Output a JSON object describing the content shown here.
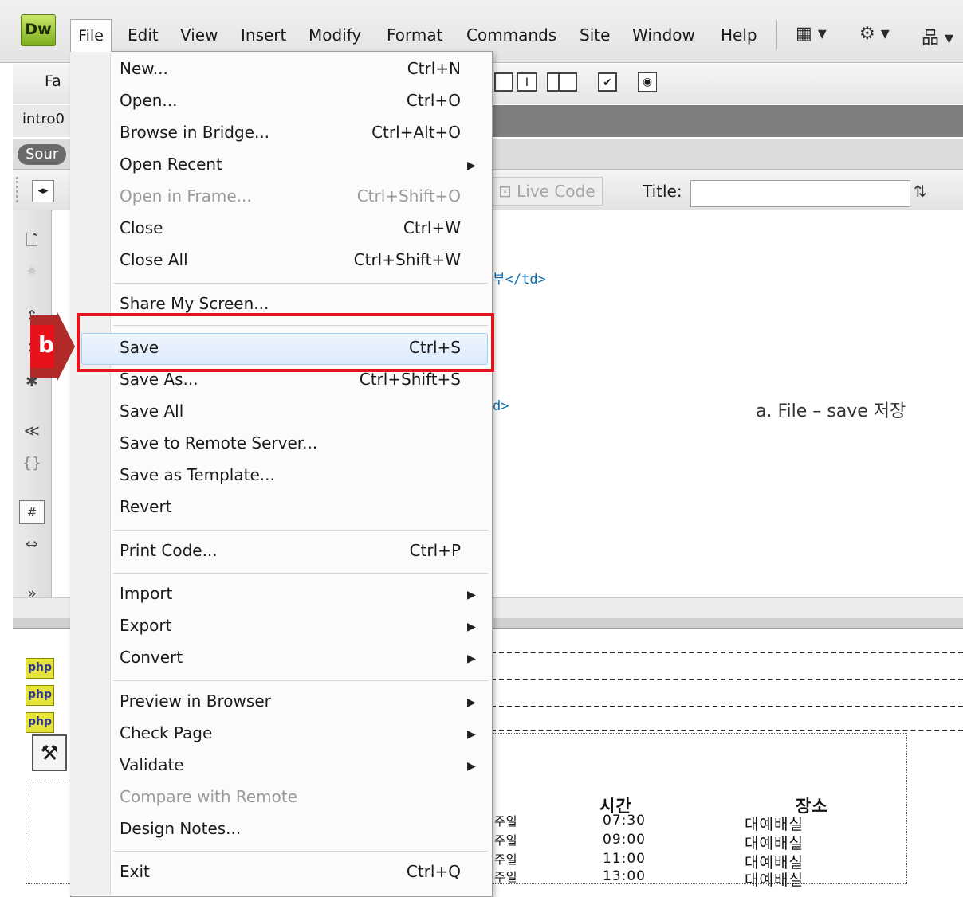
{
  "app": {
    "logo_text": "Dw"
  },
  "menubar": {
    "items": [
      "File",
      "Edit",
      "View",
      "Insert",
      "Modify",
      "Format",
      "Commands",
      "Site",
      "Window",
      "Help"
    ],
    "layout_icon": "layout-icon",
    "gear_icon": "gear-icon",
    "site_icon": "site-icon"
  },
  "insert_toolbar": {
    "category_label": "Fa"
  },
  "document": {
    "tab_name": "intro0",
    "source_label": "Sour"
  },
  "doc_toolbar": {
    "live_code_label": "Live Code",
    "title_label": "Title:",
    "title_value": ""
  },
  "code_view": {
    "line1": "부</td>",
    "line2": "d>"
  },
  "annotation": {
    "text": "a.   File – save 저장"
  },
  "design_view": {
    "php_badge": "php",
    "header_time": "시간",
    "header_place": "장소",
    "rows": [
      {
        "day": "주일",
        "time": "07:30",
        "place": "대예배실"
      },
      {
        "day": "주일",
        "time": "09:00",
        "place": "대예배실"
      },
      {
        "day": "주일",
        "time": "11:00",
        "place": "대예배실"
      },
      {
        "day": "주일",
        "time": "13:00",
        "place": "대예배실"
      }
    ]
  },
  "file_menu": {
    "items": [
      {
        "label": "New...",
        "shortcut": "Ctrl+N"
      },
      {
        "label": "Open...",
        "shortcut": "Ctrl+O"
      },
      {
        "label": "Browse in Bridge...",
        "shortcut": "Ctrl+Alt+O"
      },
      {
        "label": "Open Recent",
        "shortcut": ""
      },
      {
        "label": "Open in Frame...",
        "shortcut": "Ctrl+Shift+O"
      },
      {
        "label": "Close",
        "shortcut": "Ctrl+W"
      },
      {
        "label": "Close All",
        "shortcut": "Ctrl+Shift+W"
      },
      {
        "label": "Share My Screen...",
        "shortcut": ""
      },
      {
        "label": "Save",
        "shortcut": "Ctrl+S"
      },
      {
        "label": "Save As...",
        "shortcut": "Ctrl+Shift+S"
      },
      {
        "label": "Save All",
        "shortcut": ""
      },
      {
        "label": "Save to Remote Server...",
        "shortcut": ""
      },
      {
        "label": "Save as Template...",
        "shortcut": ""
      },
      {
        "label": "Revert",
        "shortcut": ""
      },
      {
        "label": "Print Code...",
        "shortcut": "Ctrl+P"
      },
      {
        "label": "Import",
        "shortcut": ""
      },
      {
        "label": "Export",
        "shortcut": ""
      },
      {
        "label": "Convert",
        "shortcut": ""
      },
      {
        "label": "Preview in Browser",
        "shortcut": ""
      },
      {
        "label": "Check Page",
        "shortcut": ""
      },
      {
        "label": "Validate",
        "shortcut": ""
      },
      {
        "label": "Compare with Remote",
        "shortcut": ""
      },
      {
        "label": "Design Notes...",
        "shortcut": ""
      },
      {
        "label": "Exit",
        "shortcut": "Ctrl+Q"
      }
    ]
  },
  "callout": {
    "label": "b",
    "color": "#e8131a"
  }
}
